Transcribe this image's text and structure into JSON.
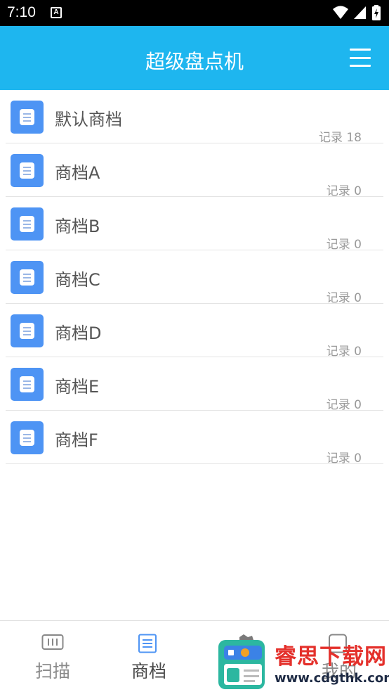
{
  "status_bar": {
    "time": "7:10",
    "notification_glyph": "A"
  },
  "app_bar": {
    "title": "超级盘点机",
    "menu_icon": "hamburger-icon"
  },
  "accent_color": "#1eb6ef",
  "icon_color": "#4e94f4",
  "stores": [
    {
      "name": "默认商档",
      "records": "记录 18"
    },
    {
      "name": "商档A",
      "records": "记录 0"
    },
    {
      "name": "商档B",
      "records": "记录 0"
    },
    {
      "name": "商档C",
      "records": "记录 0"
    },
    {
      "name": "商档D",
      "records": "记录 0"
    },
    {
      "name": "商档E",
      "records": "记录 0"
    },
    {
      "name": "商档F",
      "records": "记录 0"
    }
  ],
  "tabs": [
    {
      "label": "扫描",
      "icon": "barcode-icon",
      "active": false
    },
    {
      "label": "商档",
      "icon": "document-list-icon",
      "active": true
    },
    {
      "label": "",
      "icon": "",
      "active": false
    },
    {
      "label": "我的",
      "icon": "user-icon",
      "active": false
    }
  ],
  "watermark": {
    "title": "睿思下载网",
    "url": "www.cdgthk.com"
  }
}
